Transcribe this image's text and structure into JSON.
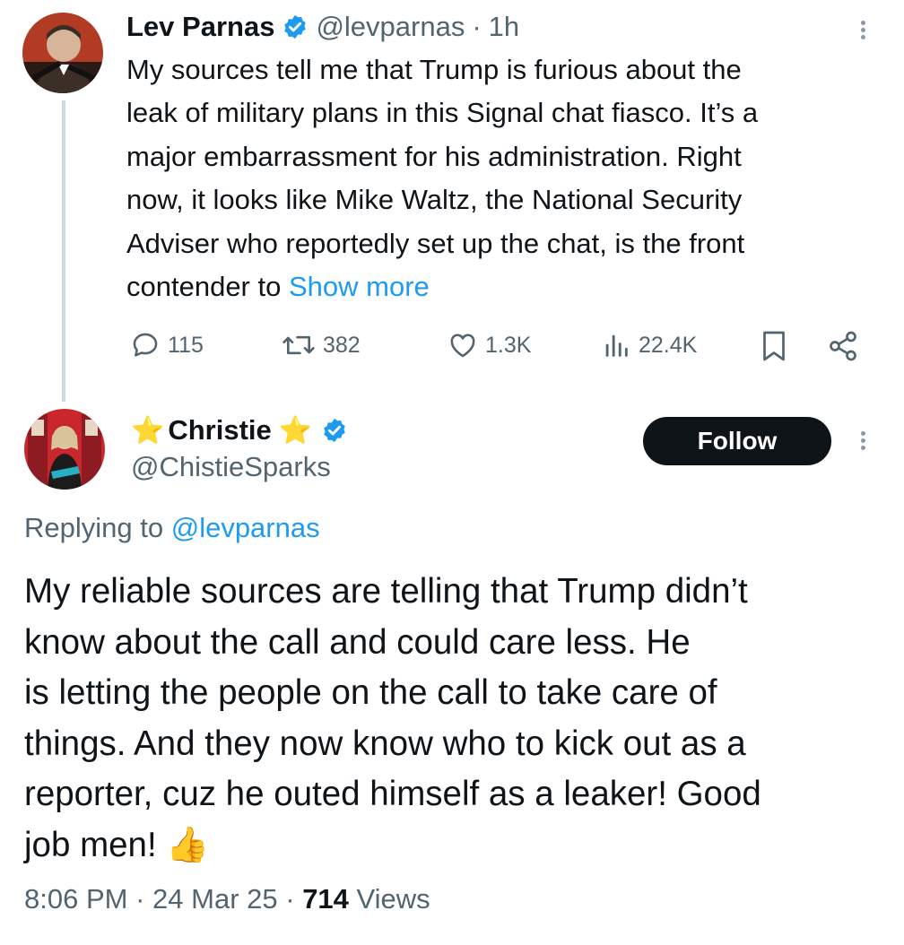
{
  "parent_tweet": {
    "author_name": "Lev Parnas",
    "handle": "@levparnas",
    "separator": "·",
    "time": "1h",
    "text_lines": [
      "My sources tell me that Trump is furious about the",
      "leak of military plans in this Signal chat fiasco. It’s a",
      "major embarrassment for his administration. Right",
      "now, it looks like Mike Waltz, the National Security",
      "Adviser who reportedly set up the chat, is the front"
    ],
    "last_line": "contender to",
    "show_more": "Show more",
    "replies": "115",
    "reposts": "382",
    "likes": "1.3K",
    "views": "22.4K"
  },
  "reply_tweet": {
    "author_name": "Christie",
    "name_emoji": "⭐",
    "handle": "@ChistieSparks",
    "follow_label": "Follow",
    "replying_prefix": "Replying to",
    "replying_handle": "@levparnas",
    "text_lines": [
      "My reliable sources are telling that Trump didn’t",
      "know about the call and could care less. He",
      "is letting the people on the call to take care of",
      "things. And they now know who to kick out as a",
      "reporter, cuz he outed himself as a leaker! Good"
    ],
    "last_line": "job men!",
    "emoji": "👍",
    "time": "8:06 PM",
    "dot": "·",
    "date": "24 Mar 25",
    "views_count": "714",
    "views_label": "Views"
  },
  "colors": {
    "text": "#0f1419",
    "secondary": "#536471",
    "link": "#1d9bf0",
    "verified": "#1d9bf0",
    "follow_bg": "#0f1419",
    "thread_line": "#cfd9de"
  }
}
